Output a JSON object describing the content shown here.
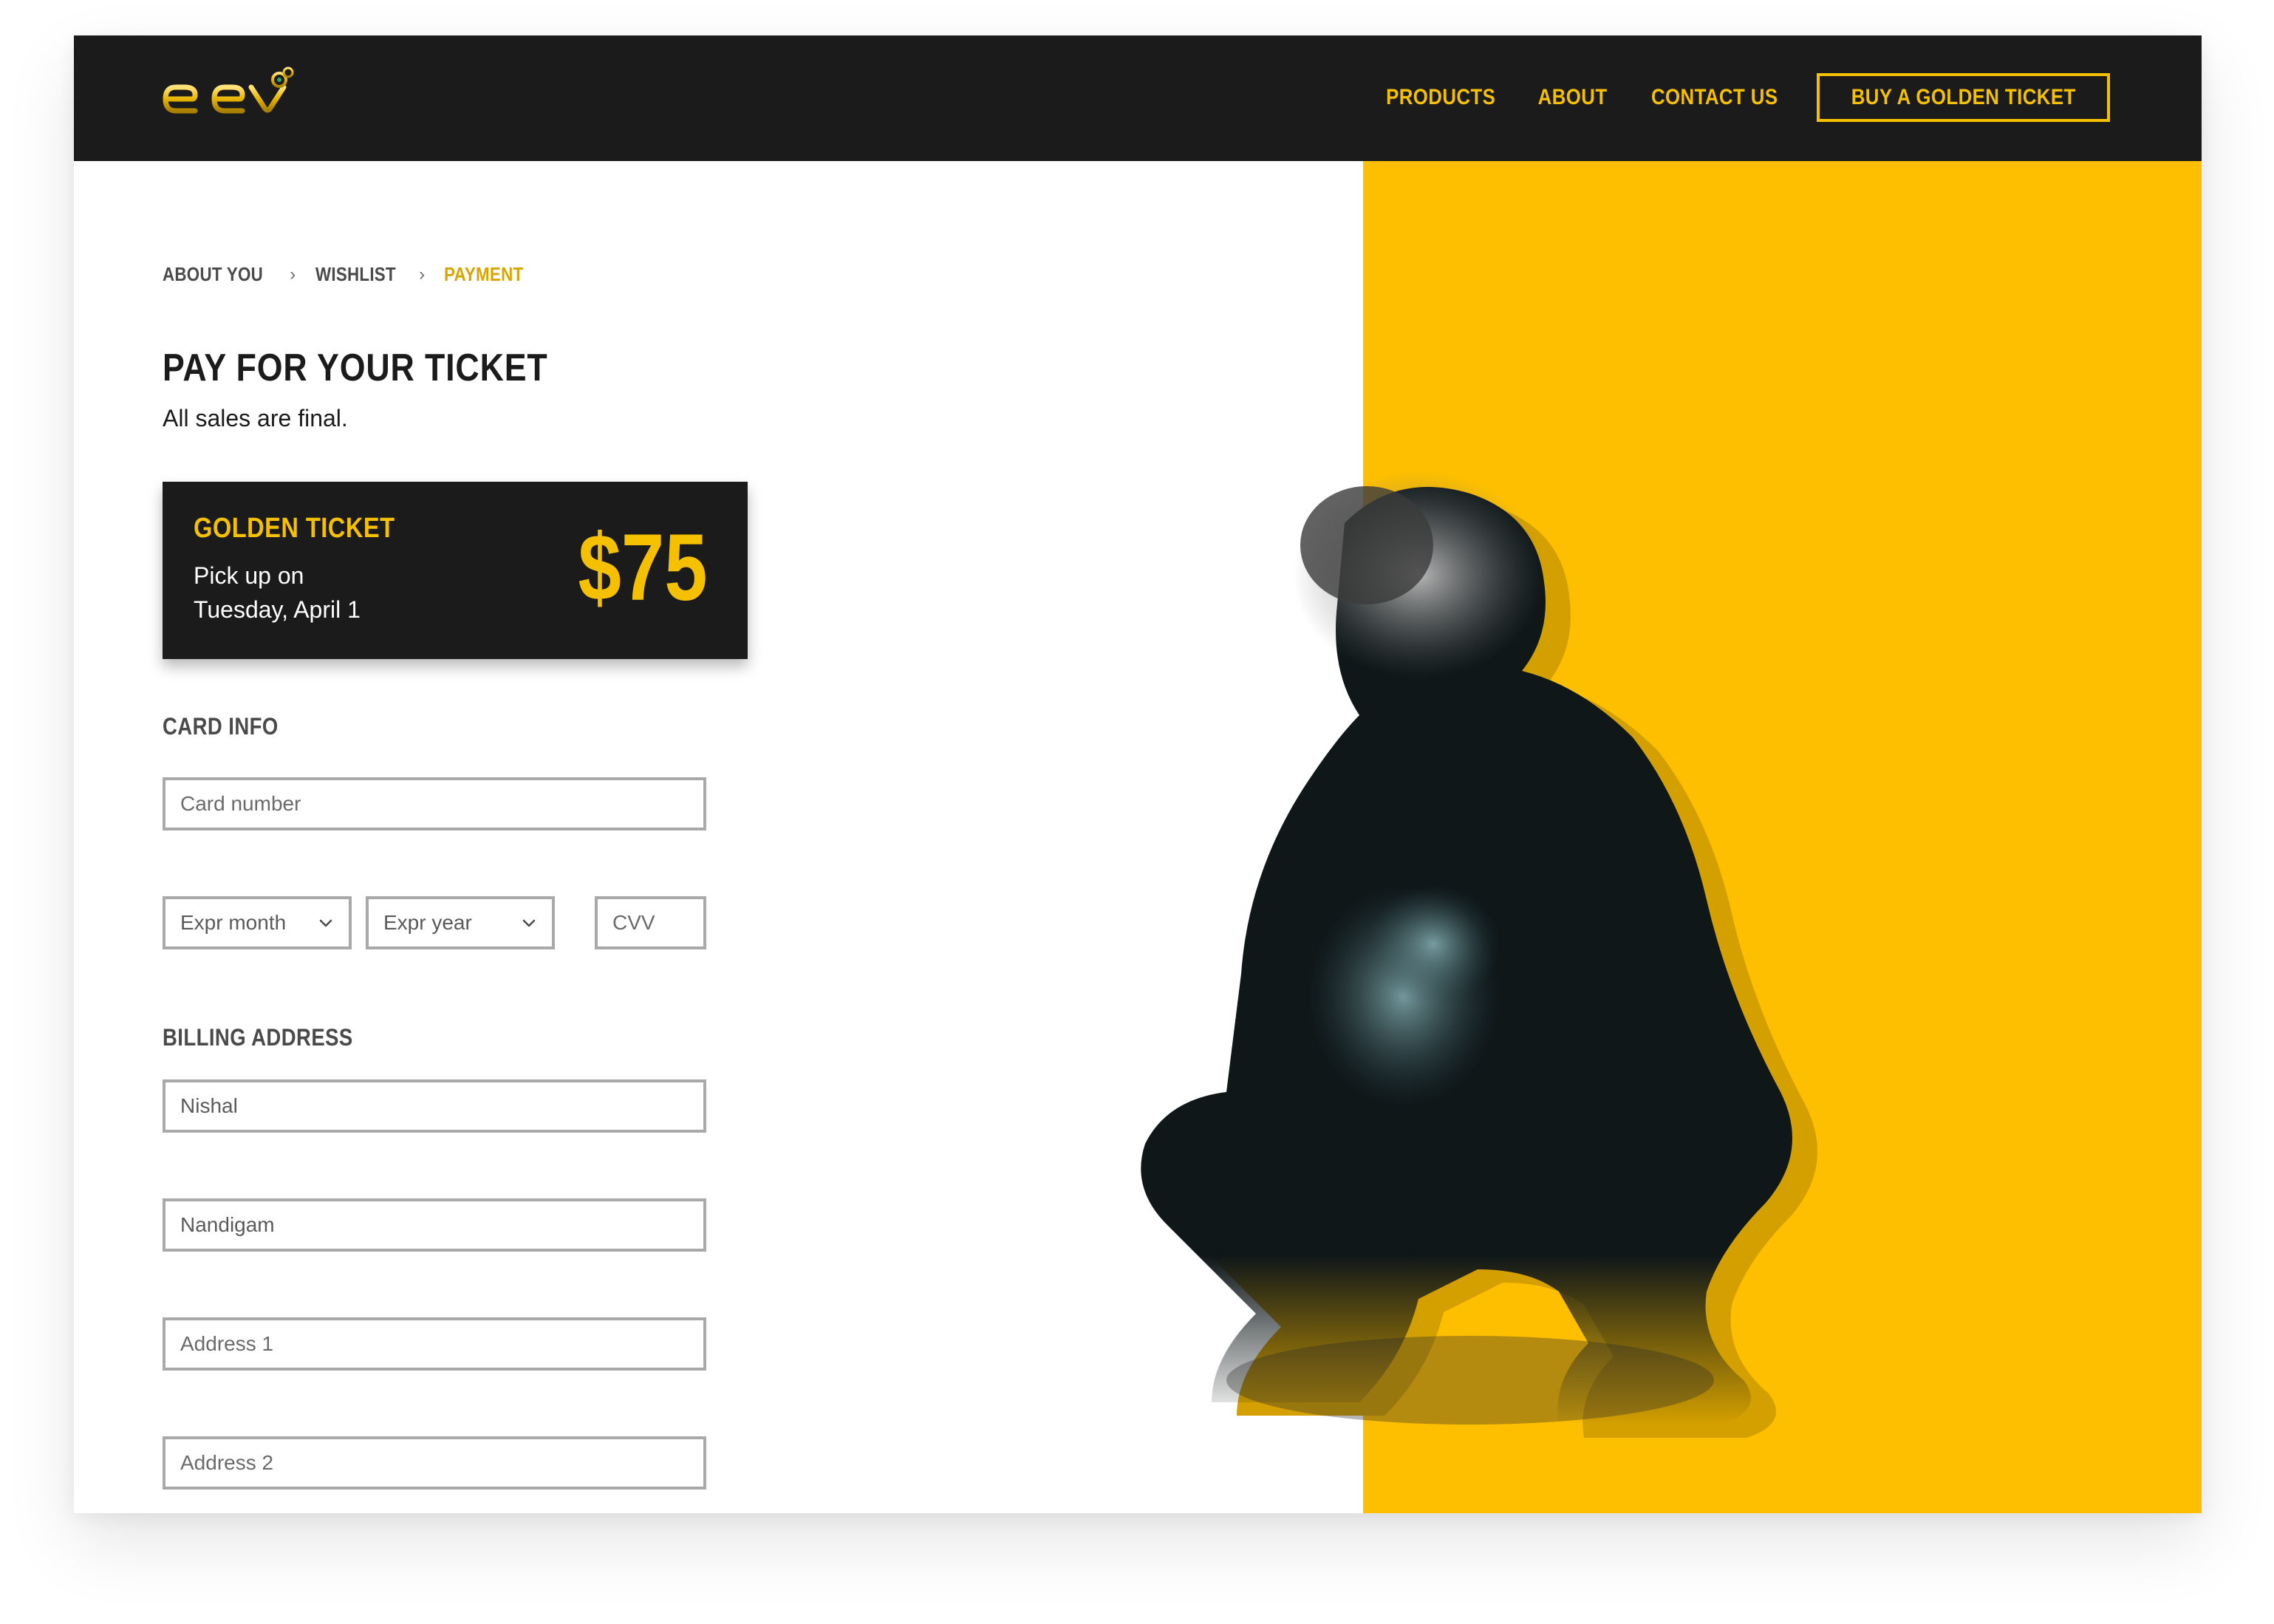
{
  "nav": {
    "logo_text": "elev",
    "links": [
      "PRODUCTS",
      "ABOUT",
      "CONTACT US"
    ],
    "cta_label": "BUY A GOLDEN TICKET"
  },
  "breadcrumb": {
    "steps": [
      "ABOUT YOU",
      "WISHLIST",
      "PAYMENT"
    ],
    "active_step": "PAYMENT"
  },
  "page": {
    "title": "PAY FOR YOUR TICKET",
    "subtitle": "All sales are final."
  },
  "ticket": {
    "name": "GOLDEN TICKET",
    "pickup_line1": "Pick up on",
    "pickup_line2": "Tuesday, April 1",
    "price": "$75"
  },
  "card_info": {
    "label": "CARD INFO",
    "card_number_placeholder": "Card number",
    "expr_month_placeholder": "Expr month",
    "expr_year_placeholder": "Expr year",
    "cvv_placeholder": "CVV"
  },
  "billing": {
    "label": "BILLING ADDRESS",
    "first_name_value": "Nishal",
    "last_name_value": "Nandigam",
    "address1_placeholder": "Address 1",
    "address2_placeholder": "Address 2"
  },
  "colors": {
    "brand_yellow": "#fdbf00",
    "accent_gold": "#f4c000",
    "nav_bg": "#1c1b1b",
    "field_border": "#a9a9a9"
  },
  "icons": {
    "logo": "elev-logo-icon",
    "select_arrow": "chevron-down-icon",
    "breadcrumb_separator": "chevron-right-icon"
  }
}
